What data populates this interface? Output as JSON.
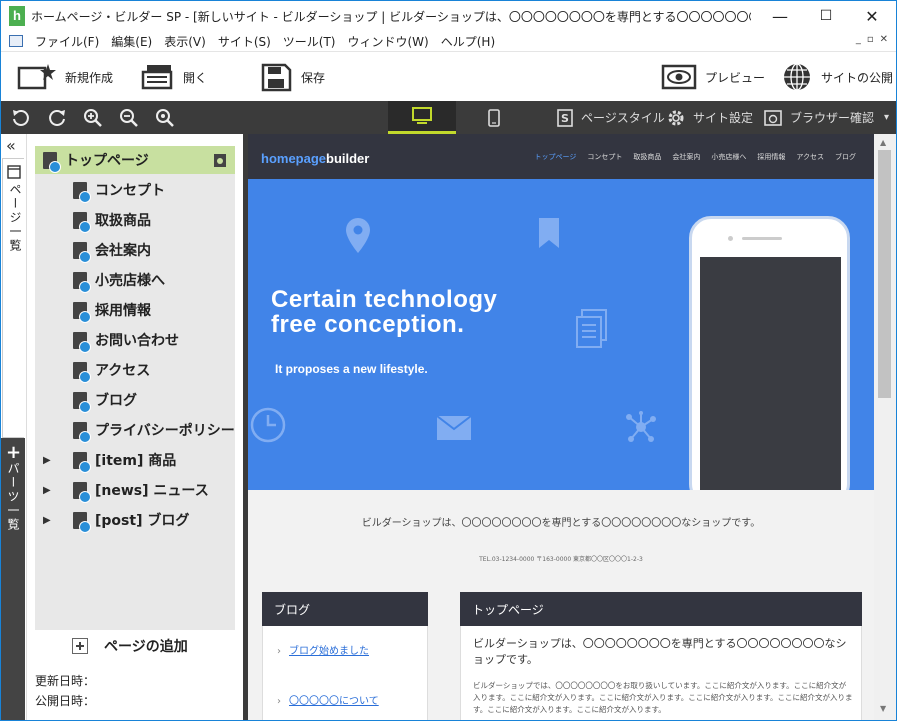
{
  "window": {
    "title": "ホームページ・ビルダー SP - [新しいサイト - ビルダーショップ | ビルダーショップは、〇〇〇〇〇〇〇〇を専門とする〇〇〇〇〇〇〇〇なショップです。]",
    "app_icon_letter": "h",
    "minimize": "—",
    "maximize": "☐",
    "close": "✕"
  },
  "menubar": {
    "items": [
      "ファイル(F)",
      "編集(E)",
      "表示(V)",
      "サイト(S)",
      "ツール(T)",
      "ウィンドウ(W)",
      "ヘルプ(H)"
    ],
    "mdi": [
      "_",
      "▫",
      "✕"
    ]
  },
  "toolbar": {
    "new": "新規作成",
    "open": "開く",
    "save": "保存",
    "preview": "プレビュー",
    "publish": "サイトの公開"
  },
  "subbar": {
    "page_style": "ページスタイル",
    "site_settings": "サイト設定",
    "browser_check": "ブラウザー確認",
    "dropdown": "▾"
  },
  "strip": {
    "collapse": "«",
    "pages_tab": "ページ一覧",
    "parts_plus": "+",
    "parts_tab": "パーツ一覧"
  },
  "tree": {
    "top": "トップページ",
    "children": [
      "コンセプト",
      "取扱商品",
      "会社案内",
      "小売店様へ",
      "採用情報",
      "お問い合わせ",
      "アクセス",
      "ブログ",
      "プライバシーポリシー"
    ],
    "groups": [
      "[item] 商品",
      "[news] ニュース",
      "[post] ブログ"
    ],
    "expand_arrow": "▶",
    "add_page": "ページの追加",
    "updated_label": "更新日時：",
    "published_label": "公開日時："
  },
  "site": {
    "logo_a": "homepage",
    "logo_b": "builder",
    "nav": [
      "トップページ",
      "コンセプト",
      "取扱商品",
      "会社案内",
      "小売店様へ",
      "採用情報",
      "アクセス",
      "ブログ"
    ],
    "hero_title_1": "Certain technology",
    "hero_title_2": "free conception.",
    "hero_sub": "It proposes a new lifestyle.",
    "band_text": "ビルダーショップは、〇〇〇〇〇〇〇〇を専門とする〇〇〇〇〇〇〇〇なショップです。",
    "band_tel": "TEL.03-1234-0000 〒163-0000 東京都〇〇区〇〇〇1-2-3",
    "blog_head": "ブログ",
    "blog_links": [
      "ブログ始めました",
      "〇〇〇〇〇について"
    ],
    "top_head": "トップページ",
    "top_title": "ビルダーショップは、〇〇〇〇〇〇〇〇を専門とする〇〇〇〇〇〇〇〇なショップです。",
    "top_body": "ビルダーショップでは、〇〇〇〇〇〇〇〇をお取り扱いしています。ここに紹介文が入ります。ここに紹介文が入ります。ここに紹介文が入ります。ここに紹介文が入ります。ここに紹介文が入ります。ここに紹介文が入ります。ここに紹介文が入ります。ここに紹介文が入ります。"
  },
  "colors": {
    "accent_green": "#c2d92c",
    "hero_blue": "#4184e8",
    "site_header": "#333540",
    "tree_selected": "#c8e0a0"
  }
}
